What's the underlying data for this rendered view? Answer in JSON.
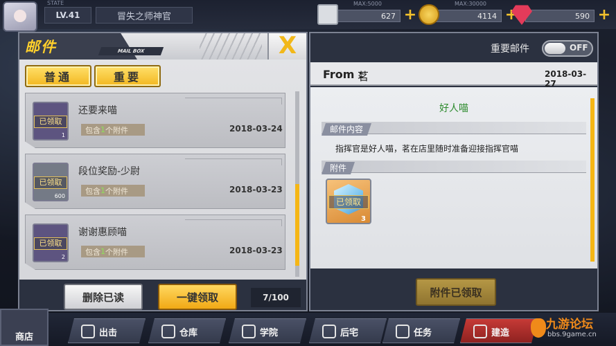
{
  "topbar": {
    "state_tag": "STATE",
    "level": "LV.41",
    "player_name": "冒失之师神官",
    "resources": [
      {
        "icon": "card-icon",
        "max": "MAX:5000",
        "value": "627"
      },
      {
        "icon": "coin-icon",
        "max": "MAX:30000",
        "value": "4114"
      },
      {
        "icon": "gem-icon",
        "max": "",
        "value": "590"
      }
    ],
    "plus": "+"
  },
  "mailbox": {
    "title": "邮件",
    "subtitle": "MAIL BOX",
    "close": "X",
    "tabs": [
      "普通",
      "重要"
    ],
    "items": [
      {
        "title": "还要来喵",
        "attach_prefix": "包含",
        "attach_count": "1",
        "attach_suffix": "个附件",
        "date": "2018-03-24",
        "status": "已领取",
        "qty": "1"
      },
      {
        "title": "段位奖励-少尉",
        "attach_prefix": "包含",
        "attach_count": "1",
        "attach_suffix": "个附件",
        "date": "2018-03-23",
        "status": "已领取",
        "qty": "600"
      },
      {
        "title": "谢谢惠顾喵",
        "attach_prefix": "包含",
        "attach_count": "1",
        "attach_suffix": "个附件",
        "date": "2018-03-23",
        "status": "已领取",
        "qty": "2"
      }
    ],
    "delete_read": "删除已读",
    "collect_all": "一键领取",
    "count": "7/100"
  },
  "detail": {
    "important_label": "重要邮件",
    "toggle_state": "OFF",
    "from_label": "From :",
    "from_name": "茗",
    "date": "2018-03-27",
    "subject": "好人喵",
    "content_header": "邮件内容",
    "content": "指挥官是好人喵，茗在店里随时准备迎接指挥官喵",
    "attachment_header": "附件",
    "attachment": {
      "status": "已领取",
      "qty": "3"
    },
    "claimed_button": "附件已领取"
  },
  "bottom_nav": {
    "shop": "商店",
    "items": [
      "出击",
      "仓库",
      "学院",
      "后宅",
      "任务",
      "建造"
    ]
  },
  "watermark": {
    "site": "九游论坛",
    "url": "bbs.9game.cn"
  },
  "colors": {
    "accent": "#f5b615",
    "subject_green": "#2c8a2c",
    "claimed_gold": "#ffe38a"
  }
}
